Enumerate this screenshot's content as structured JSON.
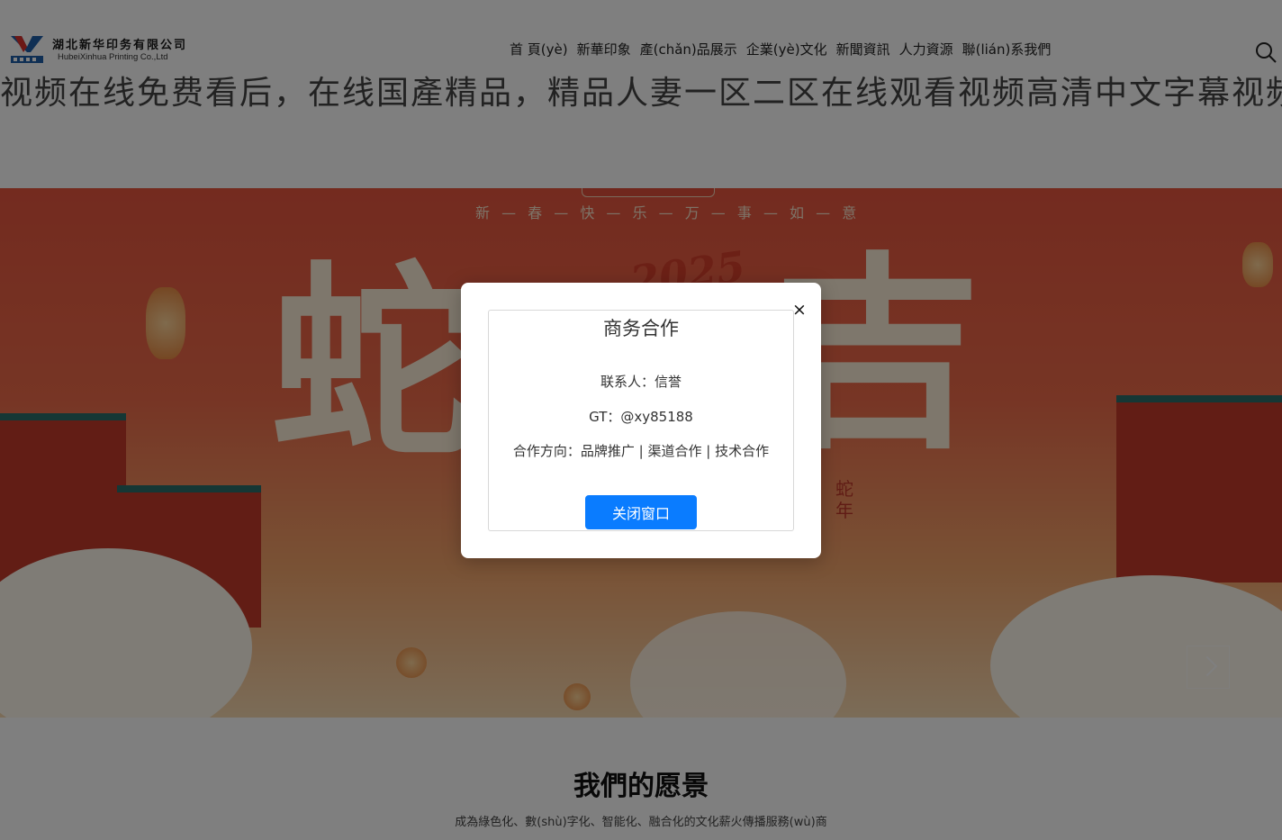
{
  "header": {
    "logo_cn": "湖北新华印务有限公司",
    "logo_en": "HubeiXinhua Printing Co.,Ltd",
    "nav": [
      "首 頁(yè)",
      "新華印象",
      "產(chǎn)品展示",
      "企業(yè)文化",
      "新聞資訊",
      "人力資源",
      "聯(lián)系我們"
    ],
    "search_icon": "search-icon"
  },
  "marquee": {
    "text": "视频在线免费看后，在线国產精品，精品人妻一区二区在线观看视频高清中文字幕视频在线免费看后，在线国產精品"
  },
  "banner": {
    "slogan": "新 — 春 — 快 — 乐 — 万 — 事 — 如 — 意",
    "char_left": "蛇",
    "char_right": "吉",
    "year": "2025",
    "vertical_text": "蛇年"
  },
  "vision": {
    "title": "我們的愿景",
    "desc": "成為綠色化、數(shù)字化、智能化、融合化的文化薪火傳播服務(wù)商"
  },
  "modal": {
    "title": "商务合作",
    "contact": "联系人：信誉",
    "gt": "GT：@xy85188",
    "direction": "合作方向：品牌推广 | 渠道合作 | 技术合作",
    "close_button": "关闭窗口",
    "close_icon": "×"
  },
  "colors": {
    "primary_button": "#0a7cff",
    "overlay": "rgba(0,0,0,0.5)",
    "banner_red": "#e8563f"
  }
}
